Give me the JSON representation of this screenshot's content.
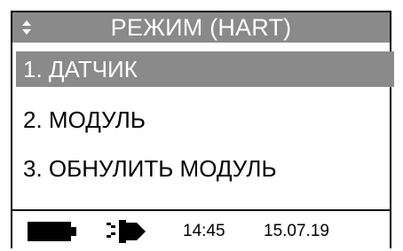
{
  "header": {
    "title": "РЕЖИМ (HART)",
    "scroll_icon": "up-down-arrows-icon"
  },
  "menu": {
    "items": [
      {
        "label": "1. ДАТЧИК",
        "selected": true
      },
      {
        "label": "2. МОДУЛЬ",
        "selected": false
      },
      {
        "label": "3. ОБНУЛИТЬ МОДУЛЬ",
        "selected": false
      }
    ]
  },
  "status_bar": {
    "battery_icon": "battery-icon",
    "connection_icon": "plug-icon",
    "time": "14:45",
    "date": "15.07.19"
  },
  "colors": {
    "highlight": "#8a8a8a",
    "foreground": "#000000",
    "background": "#ffffff"
  }
}
